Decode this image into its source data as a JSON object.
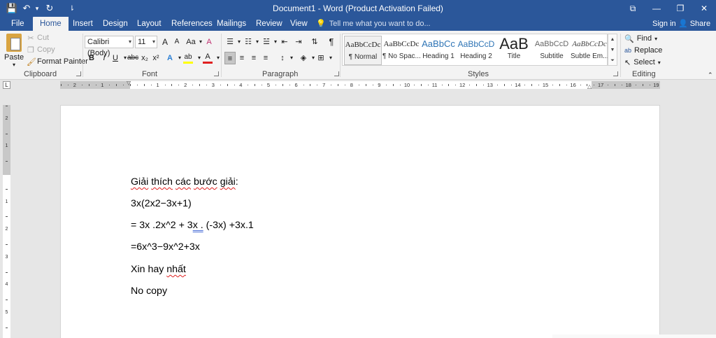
{
  "titlebar": {
    "title": "Document1 - Word (Product Activation Failed)",
    "qat": {
      "save_icon": "💾",
      "undo_icon": "↶",
      "undo_dd": "▾",
      "redo_icon": "↻",
      "customize_icon": "⇂"
    },
    "controls": {
      "ribbon_display": "⧉",
      "minimize": "—",
      "restore": "❐",
      "close": "✕"
    }
  },
  "tabs": {
    "items": [
      "File",
      "Home",
      "Insert",
      "Design",
      "Layout",
      "References",
      "Mailings",
      "Review",
      "View"
    ],
    "active": "Home",
    "tell_me": "Tell me what you want to do...",
    "sign_in": "Sign in",
    "share": "Share"
  },
  "ribbon": {
    "clipboard": {
      "label": "Clipboard",
      "paste": "Paste",
      "paste_dd": "▾",
      "cut": "Cut",
      "copy": "Copy",
      "format_painter": "Format Painter"
    },
    "font": {
      "label": "Font",
      "font_name": "Calibri (Body)",
      "font_size": "11",
      "grow": "A",
      "shrink": "A",
      "change_case": "Aa",
      "clear_format": "A",
      "bold": "B",
      "italic": "I",
      "underline": "U",
      "strike": "abc",
      "subscript": "x₂",
      "superscript": "x²",
      "text_effects": "A",
      "highlight": "ab",
      "font_color": "A"
    },
    "paragraph": {
      "label": "Paragraph",
      "show_marks": "¶"
    },
    "styles": {
      "label": "Styles",
      "items": [
        {
          "preview": "AaBbCcDc",
          "name": "¶ Normal"
        },
        {
          "preview": "AaBbCcDc",
          "name": "¶ No Spac..."
        },
        {
          "preview": "AaBbCc",
          "name": "Heading 1"
        },
        {
          "preview": "AaBbCcD",
          "name": "Heading 2"
        },
        {
          "preview": "AaB",
          "name": "Title"
        },
        {
          "preview": "AaBbCcD",
          "name": "Subtitle"
        },
        {
          "preview": "AaBbCcDc",
          "name": "Subtle Em..."
        }
      ]
    },
    "editing": {
      "label": "Editing",
      "find": "Find",
      "replace": "Replace",
      "select": "Select"
    }
  },
  "colors": {
    "accent": "#2b579a",
    "ribbon_bg": "#f3f3f3",
    "workspace_bg": "#e6e6e6",
    "highlight_yellow": "#ffff00",
    "font_red": "#e02020"
  },
  "ruler": {
    "corner": "L",
    "numbers": [
      "2",
      "1",
      "1",
      "2",
      "3",
      "4",
      "5",
      "6",
      "7",
      "8",
      "9",
      "10",
      "11",
      "12",
      "13",
      "14",
      "15",
      "16",
      "17",
      "18",
      "19"
    ],
    "vertical_numbers": [
      "2",
      "1",
      "1",
      "2",
      "3",
      "4",
      "5"
    ]
  },
  "document": {
    "lines": [
      {
        "parts": [
          {
            "t": "Giải",
            "s": "squig"
          },
          {
            "t": " "
          },
          {
            "t": "thích",
            "s": "squig"
          },
          {
            "t": " "
          },
          {
            "t": "các",
            "s": "squig"
          },
          {
            "t": " "
          },
          {
            "t": "bước",
            "s": "squig"
          },
          {
            "t": " "
          },
          {
            "t": "giải",
            "s": "squig"
          },
          {
            "t": ":"
          }
        ]
      },
      {
        "parts": [
          {
            "t": "3x(2x2−3x+1)"
          }
        ]
      },
      {
        "parts": [
          {
            "t": "= 3x .2x^2 + 3"
          },
          {
            "t": "x .",
            "s": "dblblue"
          },
          {
            "t": " (-3x) +3x.1"
          }
        ]
      },
      {
        "parts": [
          {
            "t": "=6x^3−9x^2+3x"
          }
        ]
      },
      {
        "parts": [
          {
            "t": "Xin hay "
          },
          {
            "t": "nhất",
            "s": "squig"
          }
        ]
      },
      {
        "parts": [
          {
            "t": "No copy"
          }
        ]
      }
    ]
  }
}
